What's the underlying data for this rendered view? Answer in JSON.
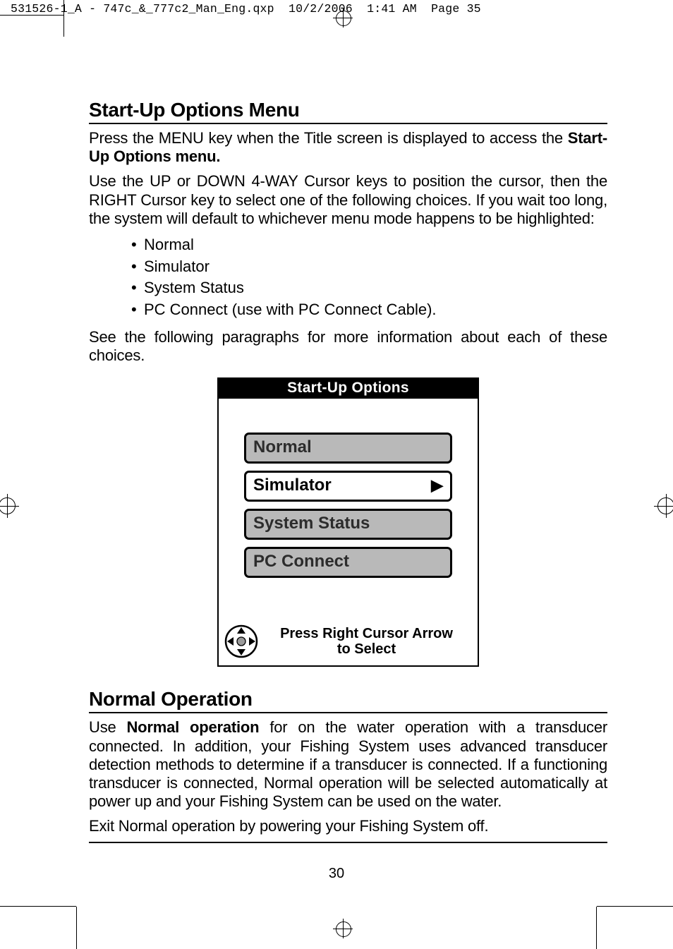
{
  "meta": {
    "filename": "531526-1_A - 747c_&_777c2_Man_Eng.qxp",
    "date": "10/2/2006",
    "time": "1:41 AM",
    "pageLabel": "Page 35"
  },
  "section1": {
    "heading": "Start-Up Options Menu",
    "p1_a": "Press the MENU key when the Title screen is displayed to access the ",
    "p1_b": "Start-Up Options menu.",
    "p2": "Use the UP or  DOWN 4-WAY Cursor keys to position the cursor, then the RIGHT Cursor key to select one of the following choices. If you wait too long, the system will default to whichever menu mode happens to be highlighted:",
    "bullets": [
      "Normal",
      "Simulator",
      "System Status",
      "PC Connect (use with PC Connect Cable)."
    ],
    "p3": "See the following paragraphs for more information about each of these choices."
  },
  "screenshot": {
    "title": "Start-Up  Options",
    "buttons": [
      {
        "label": "Normal",
        "selected": false,
        "arrow": false
      },
      {
        "label": "Simulator",
        "selected": true,
        "arrow": true
      },
      {
        "label": "System  Status",
        "selected": false,
        "arrow": false
      },
      {
        "label": "PC  Connect",
        "selected": false,
        "arrow": false
      }
    ],
    "footer_l1": "Press  Right  Cursor  Arrow",
    "footer_l2": "to   Select"
  },
  "section2": {
    "heading": "Normal Operation",
    "p1_a": "Use ",
    "p1_b": "Normal operation",
    "p1_c": " for on the water operation with a transducer connected. In addition, your Fishing System uses advanced transducer detection methods to determine if a transducer is connected. If a functioning transducer is connected, Normal operation will be selected automatically at power up and your Fishing System can be used on the water.",
    "p2": "Exit Normal operation by powering your Fishing System off."
  },
  "pageNumber": "30"
}
